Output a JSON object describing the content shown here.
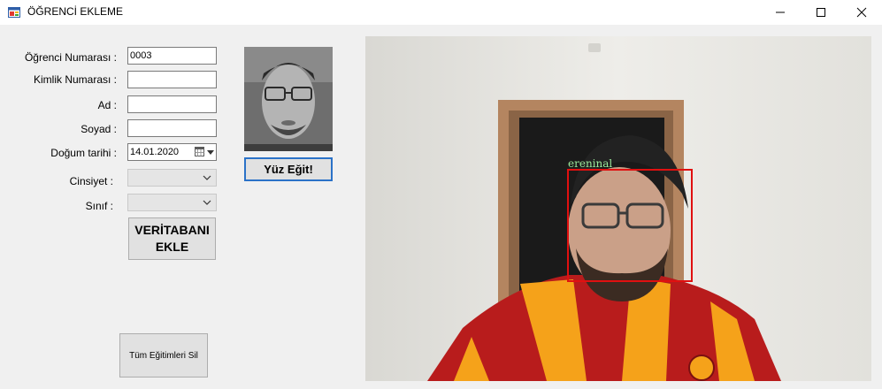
{
  "window": {
    "title": "ÖĞRENCİ EKLEME",
    "controls": [
      "minimize",
      "maximize",
      "close"
    ]
  },
  "form": {
    "student_number_label": "Öğrenci Numarası :",
    "student_number_value": "0003",
    "id_number_label": "Kimlik Numarası :",
    "id_number_value": "",
    "name_label": "Ad :",
    "name_value": "",
    "surname_label": "Soyad :",
    "surname_value": "",
    "birthdate_label": "Doğum tarihi :",
    "birthdate_value": "14.01.2020",
    "gender_label": "Cinsiyet :",
    "gender_value": "",
    "class_label": "Sınıf :",
    "class_value": ""
  },
  "buttons": {
    "add_db_line1": "VERİTABANI",
    "add_db_line2": "EKLE",
    "train_face": "Yüz Eğit!",
    "delete_all_trainings": "Tüm Eğitimleri Sil"
  },
  "camera": {
    "detected_name": "ereninal",
    "box_color": "#e01010",
    "label_color": "#9be89b"
  },
  "icons": {
    "app": "form-icon",
    "calendar": "calendar-icon",
    "dropdown": "chevron-down-icon"
  }
}
